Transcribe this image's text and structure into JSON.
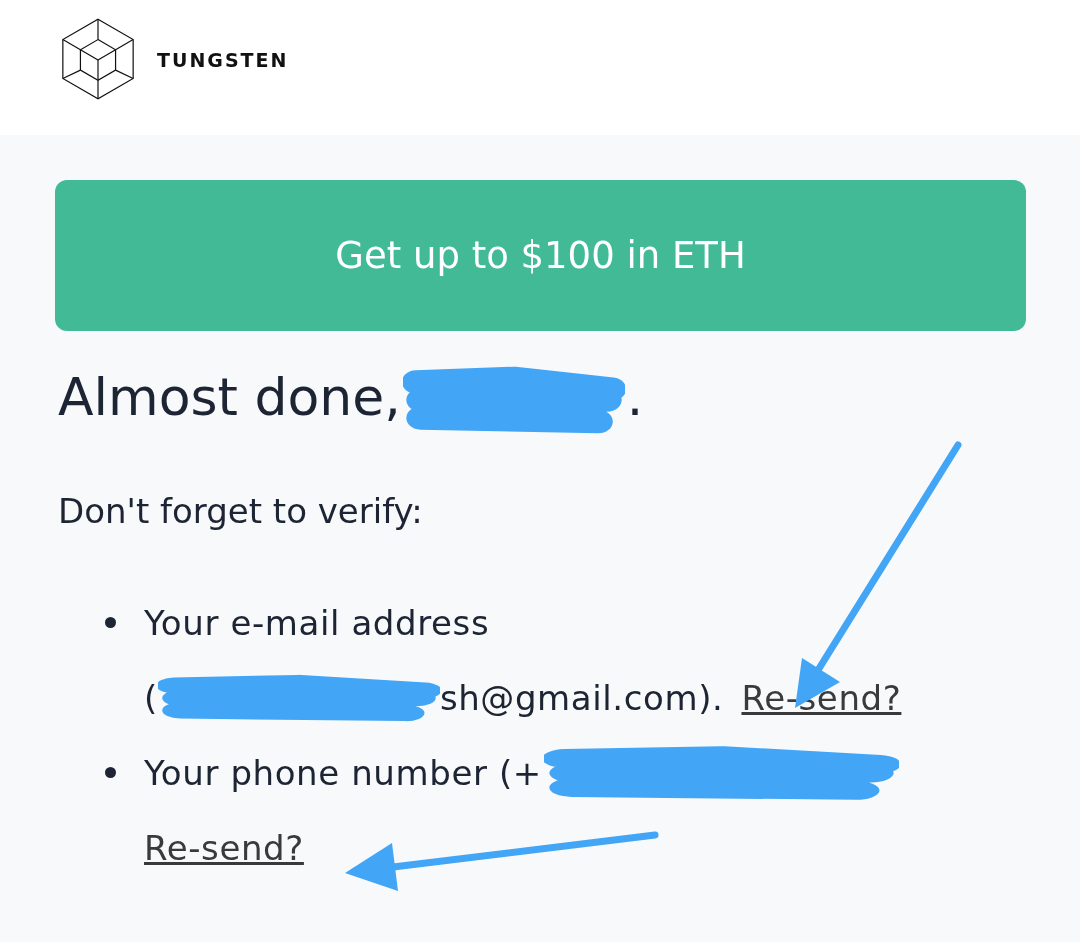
{
  "header": {
    "brand": "TUNGSTEN"
  },
  "banner": {
    "label": "Get up to $100 in ETH"
  },
  "heading": [
    {
      "kind": "text",
      "text": "Almost done,"
    },
    {
      "kind": "redaction"
    },
    {
      "kind": "text",
      "text": "."
    }
  ],
  "intro": "Don't forget to verify:",
  "items": [
    {
      "lines": [
        [
          {
            "kind": "text",
            "text": "Your e-mail address"
          }
        ],
        [
          {
            "kind": "text",
            "text": "("
          },
          {
            "kind": "redaction"
          },
          {
            "kind": "text",
            "text": "sh@gmail.com)."
          },
          {
            "kind": "link",
            "text": "Re-send?"
          }
        ]
      ]
    },
    {
      "lines": [
        [
          {
            "kind": "text",
            "text": "Your phone number (+"
          },
          {
            "kind": "redaction"
          }
        ],
        [
          {
            "kind": "link",
            "text": "Re-send?"
          }
        ]
      ]
    }
  ]
}
